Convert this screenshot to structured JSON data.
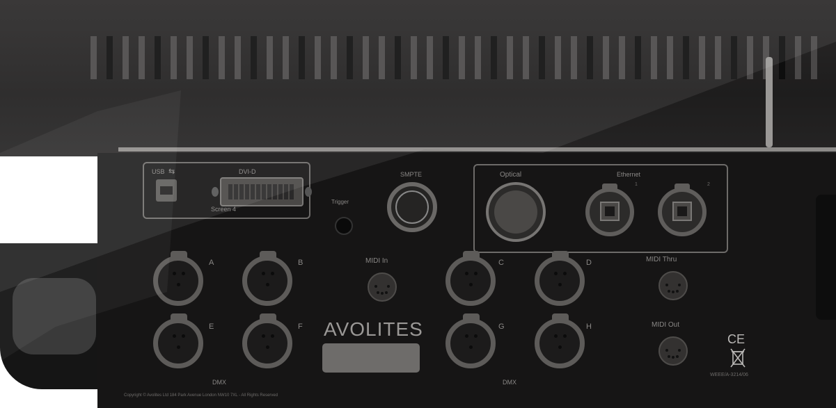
{
  "panel": {
    "usb_label": "USB",
    "dvi_label": "DVI-D",
    "screen_label": "Screen 4",
    "trigger_label": "Trigger",
    "smpte_label": "SMPTE",
    "optical_label": "Optical",
    "ethernet_label": "Ethernet",
    "ethernet_1": "1",
    "ethernet_2": "2",
    "dmx_a": "A",
    "dmx_b": "B",
    "dmx_c": "C",
    "dmx_d": "D",
    "dmx_e": "E",
    "dmx_f": "F",
    "dmx_g": "G",
    "dmx_h": "H",
    "midi_in": "MIDI In",
    "midi_thru": "MIDI Thru",
    "midi_out": "MIDI Out",
    "dmx_left": "DMX",
    "dmx_right": "DMX",
    "brand": "AVOLITES",
    "ce": "CE",
    "serial": "WEEE/A-3214/06",
    "copyright": "Copyright © Avolites Ltd 184 Park Avenue London NW10 7XL - All Rights Reserved"
  },
  "colors": {
    "panel": "#161515",
    "connector": "#5d5b59",
    "label": "#8a8886"
  },
  "icons": [
    "usb-icon",
    "weee-bin-icon",
    "ce-mark-icon"
  ]
}
